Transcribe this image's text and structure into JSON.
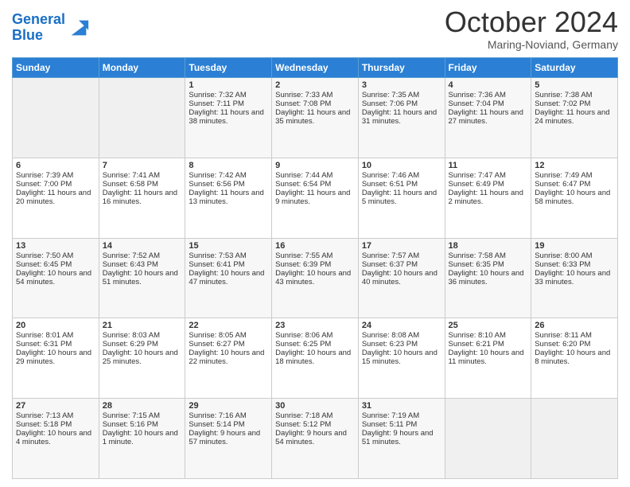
{
  "logo": {
    "part1": "General",
    "part2": "Blue"
  },
  "header": {
    "title": "October 2024",
    "location": "Maring-Noviand, Germany"
  },
  "days": [
    "Sunday",
    "Monday",
    "Tuesday",
    "Wednesday",
    "Thursday",
    "Friday",
    "Saturday"
  ],
  "weeks": [
    [
      {
        "day": "",
        "sunrise": "",
        "sunset": "",
        "daylight": ""
      },
      {
        "day": "",
        "sunrise": "",
        "sunset": "",
        "daylight": ""
      },
      {
        "day": "1",
        "sunrise": "Sunrise: 7:32 AM",
        "sunset": "Sunset: 7:11 PM",
        "daylight": "Daylight: 11 hours and 38 minutes."
      },
      {
        "day": "2",
        "sunrise": "Sunrise: 7:33 AM",
        "sunset": "Sunset: 7:08 PM",
        "daylight": "Daylight: 11 hours and 35 minutes."
      },
      {
        "day": "3",
        "sunrise": "Sunrise: 7:35 AM",
        "sunset": "Sunset: 7:06 PM",
        "daylight": "Daylight: 11 hours and 31 minutes."
      },
      {
        "day": "4",
        "sunrise": "Sunrise: 7:36 AM",
        "sunset": "Sunset: 7:04 PM",
        "daylight": "Daylight: 11 hours and 27 minutes."
      },
      {
        "day": "5",
        "sunrise": "Sunrise: 7:38 AM",
        "sunset": "Sunset: 7:02 PM",
        "daylight": "Daylight: 11 hours and 24 minutes."
      }
    ],
    [
      {
        "day": "6",
        "sunrise": "Sunrise: 7:39 AM",
        "sunset": "Sunset: 7:00 PM",
        "daylight": "Daylight: 11 hours and 20 minutes."
      },
      {
        "day": "7",
        "sunrise": "Sunrise: 7:41 AM",
        "sunset": "Sunset: 6:58 PM",
        "daylight": "Daylight: 11 hours and 16 minutes."
      },
      {
        "day": "8",
        "sunrise": "Sunrise: 7:42 AM",
        "sunset": "Sunset: 6:56 PM",
        "daylight": "Daylight: 11 hours and 13 minutes."
      },
      {
        "day": "9",
        "sunrise": "Sunrise: 7:44 AM",
        "sunset": "Sunset: 6:54 PM",
        "daylight": "Daylight: 11 hours and 9 minutes."
      },
      {
        "day": "10",
        "sunrise": "Sunrise: 7:46 AM",
        "sunset": "Sunset: 6:51 PM",
        "daylight": "Daylight: 11 hours and 5 minutes."
      },
      {
        "day": "11",
        "sunrise": "Sunrise: 7:47 AM",
        "sunset": "Sunset: 6:49 PM",
        "daylight": "Daylight: 11 hours and 2 minutes."
      },
      {
        "day": "12",
        "sunrise": "Sunrise: 7:49 AM",
        "sunset": "Sunset: 6:47 PM",
        "daylight": "Daylight: 10 hours and 58 minutes."
      }
    ],
    [
      {
        "day": "13",
        "sunrise": "Sunrise: 7:50 AM",
        "sunset": "Sunset: 6:45 PM",
        "daylight": "Daylight: 10 hours and 54 minutes."
      },
      {
        "day": "14",
        "sunrise": "Sunrise: 7:52 AM",
        "sunset": "Sunset: 6:43 PM",
        "daylight": "Daylight: 10 hours and 51 minutes."
      },
      {
        "day": "15",
        "sunrise": "Sunrise: 7:53 AM",
        "sunset": "Sunset: 6:41 PM",
        "daylight": "Daylight: 10 hours and 47 minutes."
      },
      {
        "day": "16",
        "sunrise": "Sunrise: 7:55 AM",
        "sunset": "Sunset: 6:39 PM",
        "daylight": "Daylight: 10 hours and 43 minutes."
      },
      {
        "day": "17",
        "sunrise": "Sunrise: 7:57 AM",
        "sunset": "Sunset: 6:37 PM",
        "daylight": "Daylight: 10 hours and 40 minutes."
      },
      {
        "day": "18",
        "sunrise": "Sunrise: 7:58 AM",
        "sunset": "Sunset: 6:35 PM",
        "daylight": "Daylight: 10 hours and 36 minutes."
      },
      {
        "day": "19",
        "sunrise": "Sunrise: 8:00 AM",
        "sunset": "Sunset: 6:33 PM",
        "daylight": "Daylight: 10 hours and 33 minutes."
      }
    ],
    [
      {
        "day": "20",
        "sunrise": "Sunrise: 8:01 AM",
        "sunset": "Sunset: 6:31 PM",
        "daylight": "Daylight: 10 hours and 29 minutes."
      },
      {
        "day": "21",
        "sunrise": "Sunrise: 8:03 AM",
        "sunset": "Sunset: 6:29 PM",
        "daylight": "Daylight: 10 hours and 25 minutes."
      },
      {
        "day": "22",
        "sunrise": "Sunrise: 8:05 AM",
        "sunset": "Sunset: 6:27 PM",
        "daylight": "Daylight: 10 hours and 22 minutes."
      },
      {
        "day": "23",
        "sunrise": "Sunrise: 8:06 AM",
        "sunset": "Sunset: 6:25 PM",
        "daylight": "Daylight: 10 hours and 18 minutes."
      },
      {
        "day": "24",
        "sunrise": "Sunrise: 8:08 AM",
        "sunset": "Sunset: 6:23 PM",
        "daylight": "Daylight: 10 hours and 15 minutes."
      },
      {
        "day": "25",
        "sunrise": "Sunrise: 8:10 AM",
        "sunset": "Sunset: 6:21 PM",
        "daylight": "Daylight: 10 hours and 11 minutes."
      },
      {
        "day": "26",
        "sunrise": "Sunrise: 8:11 AM",
        "sunset": "Sunset: 6:20 PM",
        "daylight": "Daylight: 10 hours and 8 minutes."
      }
    ],
    [
      {
        "day": "27",
        "sunrise": "Sunrise: 7:13 AM",
        "sunset": "Sunset: 5:18 PM",
        "daylight": "Daylight: 10 hours and 4 minutes."
      },
      {
        "day": "28",
        "sunrise": "Sunrise: 7:15 AM",
        "sunset": "Sunset: 5:16 PM",
        "daylight": "Daylight: 10 hours and 1 minute."
      },
      {
        "day": "29",
        "sunrise": "Sunrise: 7:16 AM",
        "sunset": "Sunset: 5:14 PM",
        "daylight": "Daylight: 9 hours and 57 minutes."
      },
      {
        "day": "30",
        "sunrise": "Sunrise: 7:18 AM",
        "sunset": "Sunset: 5:12 PM",
        "daylight": "Daylight: 9 hours and 54 minutes."
      },
      {
        "day": "31",
        "sunrise": "Sunrise: 7:19 AM",
        "sunset": "Sunset: 5:11 PM",
        "daylight": "Daylight: 9 hours and 51 minutes."
      },
      {
        "day": "",
        "sunrise": "",
        "sunset": "",
        "daylight": ""
      },
      {
        "day": "",
        "sunrise": "",
        "sunset": "",
        "daylight": ""
      }
    ]
  ]
}
